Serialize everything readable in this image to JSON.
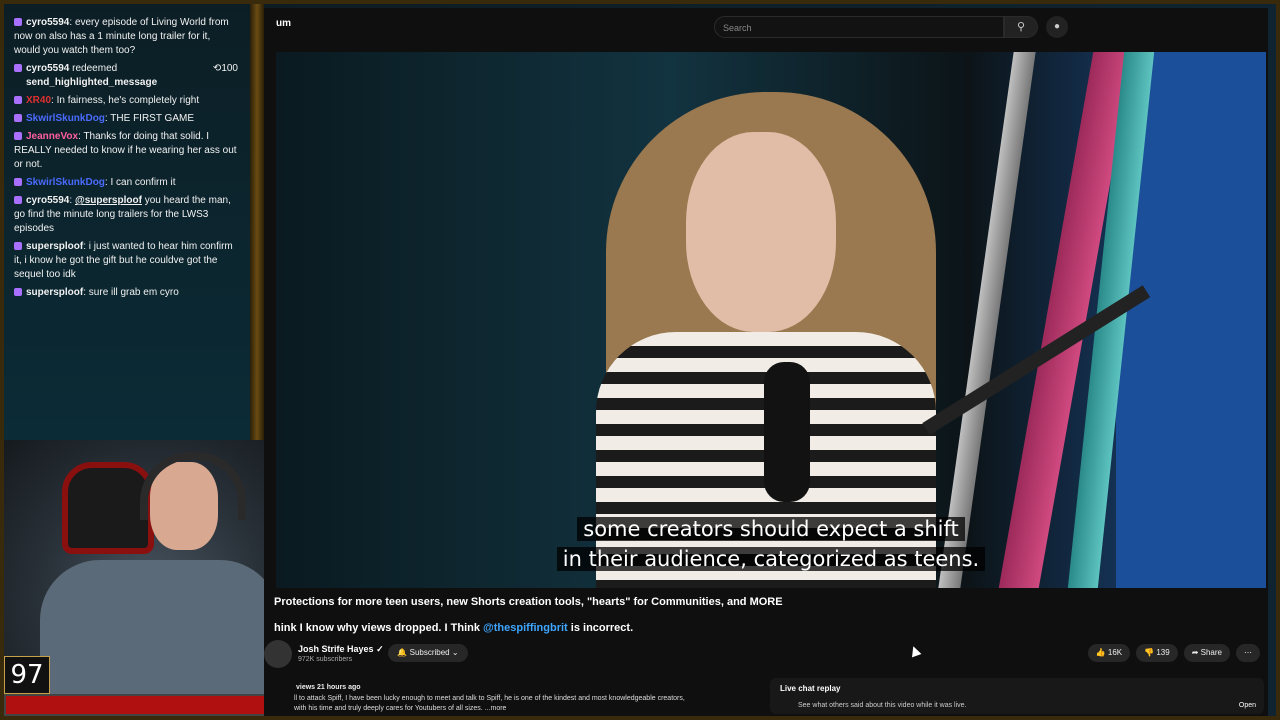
{
  "chat": {
    "messages": [
      {
        "user": "cyro5594",
        "text": "every episode of Living World from now on also has a 1 minute long trailer for it, would you watch them too?",
        "color": "#ffffff"
      },
      {
        "user": "cyro5594",
        "text": "redeemed",
        "sub": "send_highlighted_message",
        "points": "100",
        "color": "#ffffff"
      },
      {
        "user": "XR40",
        "text": "In fairness, he's completely right",
        "color": "#e03030"
      },
      {
        "user": "SkwirlSkunkDog",
        "text": "THE FIRST GAME",
        "color": "#4a6bff"
      },
      {
        "user": "JeanneVox",
        "text": "Thanks for doing that solid. I REALLY needed to know if he wearing her ass out or not.",
        "color": "#ff5fa0"
      },
      {
        "user": "SkwirlSkunkDog",
        "text": "I can confirm it",
        "color": "#4a6bff"
      },
      {
        "user": "cyro5594",
        "mention": "@supersploof",
        "text": "you heard the man, go find the minute long trailers for the LWS3 episodes",
        "color": "#ffffff"
      },
      {
        "user": "supersploof",
        "text": "i just wanted to hear him confirm it, i know he got the gift but he couldve got the sequel too idk",
        "color": "#ffffff"
      },
      {
        "user": "supersploof",
        "text": "sure ill grab em cyro",
        "color": "#ffffff"
      }
    ]
  },
  "overlay": {
    "counter": "97"
  },
  "youtube": {
    "search_placeholder": "Search",
    "logo": "um",
    "caption_line1": "some creators should expect a shift",
    "caption_line2": "in their audience, categorized as teens.",
    "title": "Protections for more teen users, new Shorts creation tools, \"hearts\" for Communities, and MORE",
    "desc_prefix": "hink I know why views dropped. I Think",
    "desc_mention": "@thespiffingbrit",
    "desc_suffix": "is incorrect.",
    "channel_name": "Josh Strife Hayes",
    "subscribers": "972K subscribers",
    "subscribe_label": "Subscribed",
    "likes": "16K",
    "dislikes": "139",
    "share_label": "Share",
    "views_line": "views  21 hours ago",
    "desc_line1": "ll to attack Spiff, I have been lucky enough to meet and talk to Spiff, he is one of the kindest and most knowledgeable creators,",
    "desc_line2": "with his time and truly deeply cares for Youtubers of all sizes.",
    "desc_more": "...more",
    "live_title": "Live chat replay",
    "live_text": "See what others said about this video while it was live.",
    "live_open": "Open"
  }
}
